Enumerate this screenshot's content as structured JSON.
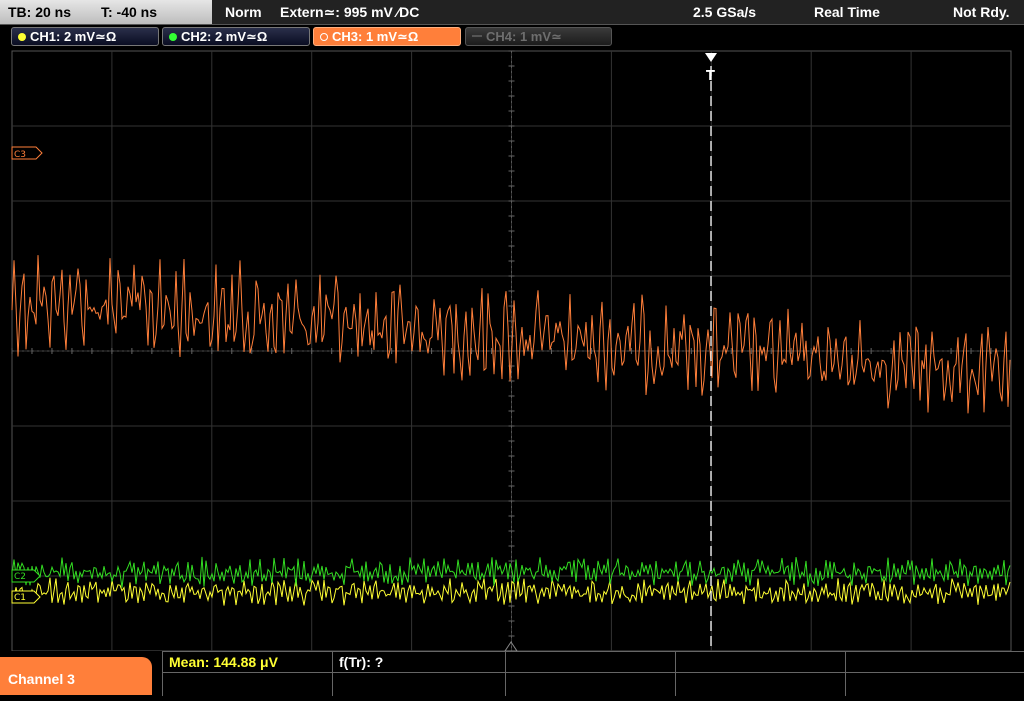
{
  "status_bar": {
    "timebase": "TB: 20 ns",
    "trigger_time": "T: -40 ns",
    "trigger_mode": "Norm",
    "trigger_source": "Extern≃: 995 mV ∕DC",
    "sample_rate": "2.5 GSa/s",
    "acq_mode": "Real Time",
    "state": "Not Rdy."
  },
  "channels": [
    {
      "label": "CH1: 2 mV≃Ω",
      "color": "#ffff33",
      "state": "on"
    },
    {
      "label": "CH2: 2 mV≃Ω",
      "color": "#33ff33",
      "state": "on"
    },
    {
      "label": "CH3: 1 mV≃Ω",
      "color": "#ff7f3a",
      "state": "selected"
    },
    {
      "label": "CH4: 1 mV≃",
      "color": "#6e6e6e",
      "state": "off"
    }
  ],
  "markers": {
    "ch3": "C3",
    "ch2": "C2",
    "ch1": "C1",
    "trigger": "T"
  },
  "colors": {
    "ch1": "#ffff33",
    "ch2": "#33dd22",
    "ch3": "#ff7f3a",
    "grid": "#3a3a3a",
    "trigger_line": "#ffffff"
  },
  "bottom": {
    "selected_channel": "Channel 3",
    "mean": "Mean: 144.88 μV",
    "freq": "f(Tr): ?"
  }
}
